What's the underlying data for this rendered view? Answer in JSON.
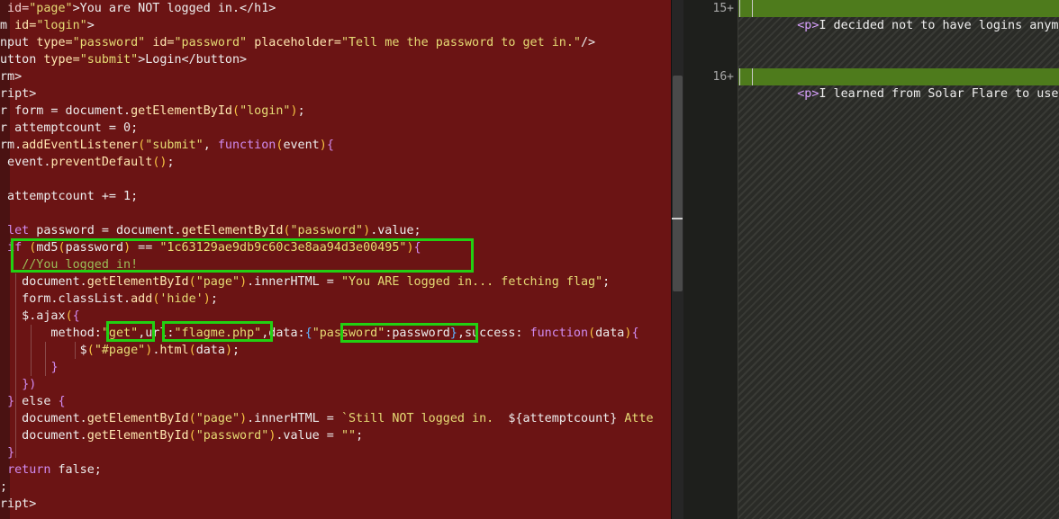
{
  "left_editor": {
    "lines": [
      [
        {
          "c": "tag",
          "t": " id="
        },
        {
          "c": "str",
          "t": "\"page\""
        },
        {
          "c": "plain",
          "t": ">You are NOT logged in.</h1>"
        }
      ],
      [
        {
          "c": "plain",
          "t": "m "
        },
        {
          "c": "attr",
          "t": "id="
        },
        {
          "c": "str",
          "t": "\"login\""
        },
        {
          "c": "plain",
          "t": ">"
        }
      ],
      [
        {
          "c": "plain",
          "t": "nput "
        },
        {
          "c": "attr",
          "t": "type="
        },
        {
          "c": "str",
          "t": "\"password\""
        },
        {
          "c": "plain",
          "t": " "
        },
        {
          "c": "attr",
          "t": "id="
        },
        {
          "c": "str",
          "t": "\"password\""
        },
        {
          "c": "plain",
          "t": " "
        },
        {
          "c": "attr",
          "t": "placeholder="
        },
        {
          "c": "str",
          "t": "\"Tell me the password to get in.\""
        },
        {
          "c": "plain",
          "t": "/>"
        }
      ],
      [
        {
          "c": "plain",
          "t": "utton "
        },
        {
          "c": "attr",
          "t": "type="
        },
        {
          "c": "str",
          "t": "\"submit\""
        },
        {
          "c": "plain",
          "t": ">Login</button>"
        }
      ],
      [
        {
          "c": "plain",
          "t": "rm>"
        }
      ],
      [
        {
          "c": "plain",
          "t": "ript>"
        }
      ],
      [
        {
          "c": "plain",
          "t": "r form = document."
        },
        {
          "c": "fn",
          "t": "getElementById"
        },
        {
          "c": "paren",
          "t": "("
        },
        {
          "c": "str",
          "t": "\"login\""
        },
        {
          "c": "paren",
          "t": ")"
        },
        {
          "c": "plain",
          "t": ";"
        }
      ],
      [
        {
          "c": "plain",
          "t": "r attemptcount = 0;"
        }
      ],
      [
        {
          "c": "plain",
          "t": "rm."
        },
        {
          "c": "fn",
          "t": "addEventListener"
        },
        {
          "c": "paren",
          "t": "("
        },
        {
          "c": "str",
          "t": "\"submit\""
        },
        {
          "c": "plain",
          "t": ", "
        },
        {
          "c": "kw",
          "t": "function"
        },
        {
          "c": "paren",
          "t": "("
        },
        {
          "c": "plain",
          "t": "event"
        },
        {
          "c": "paren",
          "t": ")"
        },
        {
          "c": "brace",
          "t": "{"
        }
      ],
      [
        {
          "c": "plain",
          "t": " event."
        },
        {
          "c": "fn",
          "t": "preventDefault"
        },
        {
          "c": "paren",
          "t": "()"
        },
        {
          "c": "plain",
          "t": ";"
        }
      ],
      [
        {
          "c": "plain",
          "t": ""
        }
      ],
      [
        {
          "c": "plain",
          "t": " attemptcount += 1;"
        }
      ],
      [
        {
          "c": "plain",
          "t": ""
        }
      ],
      [
        {
          "c": "plain",
          "t": " "
        },
        {
          "c": "kw",
          "t": "let"
        },
        {
          "c": "plain",
          "t": " password = document."
        },
        {
          "c": "fn",
          "t": "getElementById"
        },
        {
          "c": "paren",
          "t": "("
        },
        {
          "c": "str",
          "t": "\"password\""
        },
        {
          "c": "paren",
          "t": ")"
        },
        {
          "c": "plain",
          "t": ".value;"
        }
      ],
      [
        {
          "c": "plain",
          "t": " "
        },
        {
          "c": "kw",
          "t": "if"
        },
        {
          "c": "plain",
          "t": " "
        },
        {
          "c": "paren",
          "t": "("
        },
        {
          "c": "plain",
          "t": "md5"
        },
        {
          "c": "paren",
          "t": "("
        },
        {
          "c": "plain",
          "t": "password"
        },
        {
          "c": "paren",
          "t": ")"
        },
        {
          "c": "plain",
          "t": " == "
        },
        {
          "c": "str",
          "t": "\"1c63129ae9db9c60c3e8aa94d3e00495\""
        },
        {
          "c": "paren",
          "t": ")"
        },
        {
          "c": "brace",
          "t": "{"
        }
      ],
      [
        {
          "c": "plain",
          "t": "   "
        },
        {
          "c": "comment",
          "t": "//You logged in!"
        }
      ],
      [
        {
          "c": "plain",
          "t": "   document."
        },
        {
          "c": "fn",
          "t": "getElementById"
        },
        {
          "c": "paren",
          "t": "("
        },
        {
          "c": "str",
          "t": "\"page\""
        },
        {
          "c": "paren",
          "t": ")"
        },
        {
          "c": "plain",
          "t": ".innerHTML = "
        },
        {
          "c": "str",
          "t": "\"You ARE logged in... fetching flag\""
        },
        {
          "c": "plain",
          "t": ";"
        }
      ],
      [
        {
          "c": "plain",
          "t": "   form.classList."
        },
        {
          "c": "fn",
          "t": "add"
        },
        {
          "c": "paren",
          "t": "("
        },
        {
          "c": "str",
          "t": "'hide'"
        },
        {
          "c": "paren",
          "t": ")"
        },
        {
          "c": "plain",
          "t": ";"
        }
      ],
      [
        {
          "c": "plain",
          "t": "   $.ajax"
        },
        {
          "c": "paren",
          "t": "("
        },
        {
          "c": "brace",
          "t": "{"
        }
      ],
      [
        {
          "c": "plain",
          "t": "       method:"
        },
        {
          "c": "str",
          "t": "\"get\""
        },
        {
          "c": "plain",
          "t": ",url:"
        },
        {
          "c": "str",
          "t": "\"flagme.php\""
        },
        {
          "c": "plain",
          "t": ",data:"
        },
        {
          "c": "brace2",
          "t": "{"
        },
        {
          "c": "str",
          "t": "\"password\""
        },
        {
          "c": "plain",
          "t": ":password"
        },
        {
          "c": "brace2",
          "t": "}"
        },
        {
          "c": "plain",
          "t": ",success: "
        },
        {
          "c": "kw",
          "t": "function"
        },
        {
          "c": "paren",
          "t": "("
        },
        {
          "c": "plain",
          "t": "data"
        },
        {
          "c": "paren",
          "t": ")"
        },
        {
          "c": "brace",
          "t": "{"
        }
      ],
      [
        {
          "c": "plain",
          "t": "           $"
        },
        {
          "c": "paren",
          "t": "("
        },
        {
          "c": "str",
          "t": "\"#page\""
        },
        {
          "c": "paren",
          "t": ")"
        },
        {
          "c": "plain",
          "t": "."
        },
        {
          "c": "fn",
          "t": "html"
        },
        {
          "c": "paren",
          "t": "("
        },
        {
          "c": "plain",
          "t": "data"
        },
        {
          "c": "paren",
          "t": ")"
        },
        {
          "c": "plain",
          "t": ";"
        }
      ],
      [
        {
          "c": "plain",
          "t": "       "
        },
        {
          "c": "brace",
          "t": "}"
        }
      ],
      [
        {
          "c": "plain",
          "t": "   "
        },
        {
          "c": "brace",
          "t": "})"
        }
      ],
      [
        {
          "c": "plain",
          "t": " "
        },
        {
          "c": "brace",
          "t": "}"
        },
        {
          "c": "plain",
          "t": " else "
        },
        {
          "c": "brace",
          "t": "{"
        }
      ],
      [
        {
          "c": "plain",
          "t": "   document."
        },
        {
          "c": "fn",
          "t": "getElementById"
        },
        {
          "c": "paren",
          "t": "("
        },
        {
          "c": "str",
          "t": "\"page\""
        },
        {
          "c": "paren",
          "t": ")"
        },
        {
          "c": "plain",
          "t": ".innerHTML = "
        },
        {
          "c": "str",
          "t": "`Still NOT logged in.  "
        },
        {
          "c": "plain",
          "t": "${attemptcount}"
        },
        {
          "c": "str",
          "t": " Atte"
        }
      ],
      [
        {
          "c": "plain",
          "t": "   document."
        },
        {
          "c": "fn",
          "t": "getElementById"
        },
        {
          "c": "paren",
          "t": "("
        },
        {
          "c": "str",
          "t": "\"password\""
        },
        {
          "c": "paren",
          "t": ")"
        },
        {
          "c": "plain",
          "t": ".value = "
        },
        {
          "c": "str",
          "t": "\"\""
        },
        {
          "c": "plain",
          "t": ";"
        }
      ],
      [
        {
          "c": "plain",
          "t": " "
        },
        {
          "c": "brace",
          "t": "}"
        }
      ],
      [
        {
          "c": "plain",
          "t": " "
        },
        {
          "c": "kw",
          "t": "return"
        },
        {
          "c": "plain",
          "t": " false;"
        }
      ],
      [
        {
          "c": "plain",
          "t": ";"
        }
      ],
      [
        {
          "c": "plain",
          "t": "ript>"
        }
      ]
    ]
  },
  "right_diff": {
    "lines": [
      {
        "num": "15",
        "marker": "+",
        "prefix": "<p>",
        "text": "I decided not to have logins anymore"
      },
      {
        "num": "16",
        "marker": "+",
        "prefix": "<p>",
        "text": "I learned from Solar Flare to use ve"
      }
    ]
  }
}
